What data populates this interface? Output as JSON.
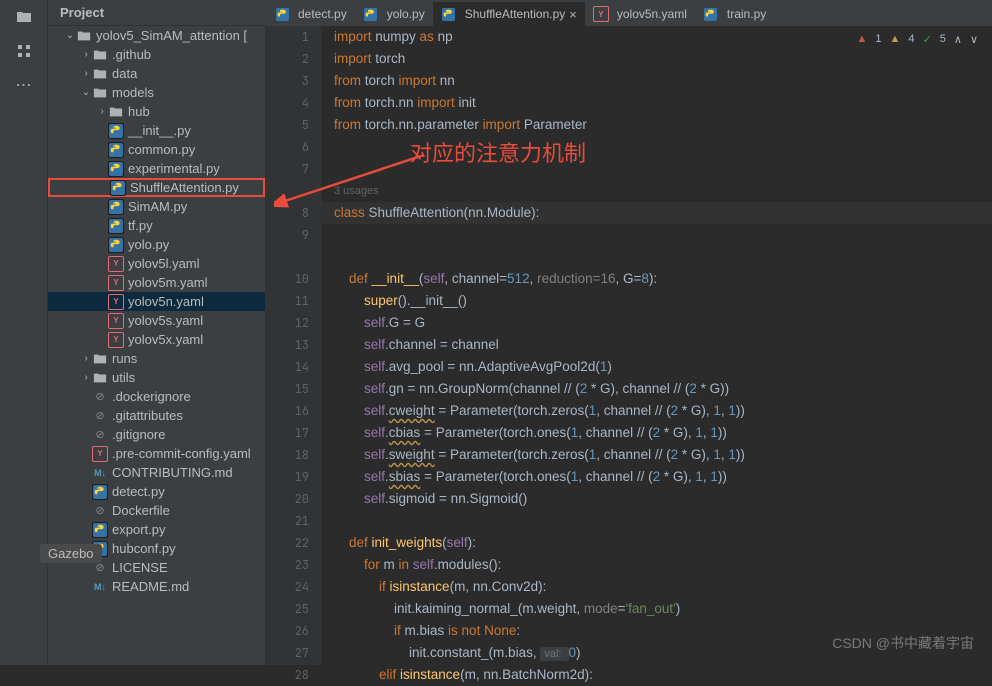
{
  "header": {
    "title": "Project"
  },
  "tree": [
    {
      "indent": 0,
      "chev": "⌄",
      "icon": "dir",
      "label": "yolov5_SimAM_attention ["
    },
    {
      "indent": 1,
      "chev": "›",
      "icon": "dir",
      "label": ".github"
    },
    {
      "indent": 1,
      "chev": "›",
      "icon": "dir",
      "label": "data"
    },
    {
      "indent": 1,
      "chev": "⌄",
      "icon": "dir",
      "label": "models"
    },
    {
      "indent": 2,
      "chev": "›",
      "icon": "dir",
      "label": "hub"
    },
    {
      "indent": 2,
      "chev": "",
      "icon": "py",
      "label": "__init__.py"
    },
    {
      "indent": 2,
      "chev": "",
      "icon": "py",
      "label": "common.py"
    },
    {
      "indent": 2,
      "chev": "",
      "icon": "py",
      "label": "experimental.py"
    },
    {
      "indent": 2,
      "chev": "",
      "icon": "py",
      "label": "ShuffleAttention.py",
      "highlighted": true
    },
    {
      "indent": 2,
      "chev": "",
      "icon": "py",
      "label": "SimAM.py"
    },
    {
      "indent": 2,
      "chev": "",
      "icon": "py",
      "label": "tf.py"
    },
    {
      "indent": 2,
      "chev": "",
      "icon": "py",
      "label": "yolo.py"
    },
    {
      "indent": 2,
      "chev": "",
      "icon": "yaml",
      "label": "yolov5l.yaml"
    },
    {
      "indent": 2,
      "chev": "",
      "icon": "yaml",
      "label": "yolov5m.yaml"
    },
    {
      "indent": 2,
      "chev": "",
      "icon": "yaml",
      "label": "yolov5n.yaml",
      "selected": true
    },
    {
      "indent": 2,
      "chev": "",
      "icon": "yaml",
      "label": "yolov5s.yaml"
    },
    {
      "indent": 2,
      "chev": "",
      "icon": "yaml",
      "label": "yolov5x.yaml"
    },
    {
      "indent": 1,
      "chev": "›",
      "icon": "dir",
      "label": "runs"
    },
    {
      "indent": 1,
      "chev": "›",
      "icon": "dir",
      "label": "utils"
    },
    {
      "indent": 1,
      "chev": "",
      "icon": "gen",
      "label": ".dockerignore"
    },
    {
      "indent": 1,
      "chev": "",
      "icon": "gen",
      "label": ".gitattributes"
    },
    {
      "indent": 1,
      "chev": "",
      "icon": "gen",
      "label": ".gitignore"
    },
    {
      "indent": 1,
      "chev": "",
      "icon": "yaml",
      "label": ".pre-commit-config.yaml"
    },
    {
      "indent": 1,
      "chev": "",
      "icon": "md",
      "label": "CONTRIBUTING.md"
    },
    {
      "indent": 1,
      "chev": "",
      "icon": "py",
      "label": "detect.py"
    },
    {
      "indent": 1,
      "chev": "",
      "icon": "gen",
      "label": "Dockerfile"
    },
    {
      "indent": 1,
      "chev": "",
      "icon": "py",
      "label": "export.py"
    },
    {
      "indent": 1,
      "chev": "",
      "icon": "py",
      "label": "hubconf.py"
    },
    {
      "indent": 1,
      "chev": "",
      "icon": "gen",
      "label": "LICENSE"
    },
    {
      "indent": 1,
      "chev": "",
      "icon": "md",
      "label": "README.md"
    }
  ],
  "tabs": [
    {
      "icon": "py",
      "label": "detect.py"
    },
    {
      "icon": "py",
      "label": "yolo.py"
    },
    {
      "icon": "py",
      "label": "ShuffleAttention.py",
      "active": true,
      "closable": true
    },
    {
      "icon": "yaml",
      "label": "yolov5n.yaml"
    },
    {
      "icon": "py",
      "label": "train.py"
    }
  ],
  "status": {
    "err": "1",
    "warn": "4",
    "ok": "5"
  },
  "usages_hint": "3 usages",
  "annotation": "对应的注意力机制",
  "gazebo": "Gazebo",
  "watermark": "CSDN @书中藏着宇宙",
  "gutter_lines": [
    "1",
    "2",
    "3",
    "4",
    "5",
    "6",
    "7",
    "",
    "8",
    "9",
    "",
    "10",
    "11",
    "12",
    "13",
    "14",
    "15",
    "16",
    "17",
    "18",
    "19",
    "20",
    "21",
    "22",
    "23",
    "24",
    "25",
    "26",
    "27",
    "28"
  ],
  "code": {
    "l1": {
      "a": "import",
      "b": " numpy ",
      "c": "as",
      "d": " np"
    },
    "l2": {
      "a": "import",
      "b": " torch"
    },
    "l3": {
      "a": "from",
      "b": " torch ",
      "c": "import",
      "d": " nn"
    },
    "l4": {
      "a": "from",
      "b": " torch.nn ",
      "c": "import",
      "d": " init"
    },
    "l5": {
      "a": "from",
      "b": " torch.nn.parameter ",
      "c": "import",
      "d": " Parameter"
    },
    "l8": {
      "a": "class ",
      "b": "ShuffleAttention",
      "c": "(nn.Module):"
    },
    "l10": {
      "a": "    ",
      "b": "def ",
      "c": "__init__",
      "d": "(",
      "e": "self",
      "f": ", channel=",
      "g": "512",
      "h": ", ",
      "i": "reduction=16",
      "j": ", G=",
      "k": "8",
      "l": "):"
    },
    "l11": {
      "a": "        ",
      "b": "super",
      "c": "().",
      "d": "__init__",
      "e": "()"
    },
    "l12": {
      "a": "        ",
      "b": "self",
      "c": ".G = G"
    },
    "l13": {
      "a": "        ",
      "b": "self",
      "c": ".channel = channel"
    },
    "l14": {
      "a": "        ",
      "b": "self",
      "c": ".avg_pool = nn.AdaptiveAvgPool2d(",
      "d": "1",
      "e": ")"
    },
    "l15": {
      "a": "        ",
      "b": "self",
      "c": ".gn = nn.GroupNorm(channel // (",
      "d": "2",
      "e": " * G), channel // (",
      "f": "2",
      "g": " * G))"
    },
    "l16": {
      "a": "        ",
      "b": "self",
      "c": ".",
      "d": "cweight",
      "e": " = Parameter(torch.zeros(",
      "f": "1",
      "g": ", channel // (",
      "h": "2",
      "i": " * G), ",
      "j": "1",
      "k": ", ",
      "l": "1",
      "m": "))"
    },
    "l17": {
      "a": "        ",
      "b": "self",
      "c": ".",
      "d": "cbias",
      "e": " = Parameter(torch.ones(",
      "f": "1",
      "g": ", channel // (",
      "h": "2",
      "i": " * G), ",
      "j": "1",
      "k": ", ",
      "l": "1",
      "m": "))"
    },
    "l18": {
      "a": "        ",
      "b": "self",
      "c": ".",
      "d": "sweight",
      "e": " = Parameter(torch.zeros(",
      "f": "1",
      "g": ", channel // (",
      "h": "2",
      "i": " * G), ",
      "j": "1",
      "k": ", ",
      "l": "1",
      "m": "))"
    },
    "l19": {
      "a": "        ",
      "b": "self",
      "c": ".",
      "d": "sbias",
      "e": " = Parameter(torch.ones(",
      "f": "1",
      "g": ", channel // (",
      "h": "2",
      "i": " * G), ",
      "j": "1",
      "k": ", ",
      "l": "1",
      "m": "))"
    },
    "l20": {
      "a": "        ",
      "b": "self",
      "c": ".sigmoid = nn.Sigmoid()"
    },
    "l22": {
      "a": "    ",
      "b": "def ",
      "c": "init_weights",
      "d": "(",
      "e": "self",
      "f": "):"
    },
    "l23": {
      "a": "        ",
      "b": "for ",
      "c": "m ",
      "d": "in ",
      "e": "self",
      "f": ".modules():"
    },
    "l24": {
      "a": "            ",
      "b": "if ",
      "c": "isinstance",
      "d": "(m, nn.Conv2d):"
    },
    "l25": {
      "a": "                init.kaiming_normal_(m.weight, ",
      "b": "mode",
      "c": "=",
      "d": "'fan_out'",
      "e": ")"
    },
    "l26": {
      "a": "                ",
      "b": "if ",
      "c": "m.bias ",
      "d": "is not None",
      "e": ":"
    },
    "l27": {
      "a": "                    init.constant_(m.bias, ",
      "hint": "val: ",
      "b": "0",
      "c": ")"
    },
    "l28": {
      "a": "            ",
      "b": "elif ",
      "c": "isinstance",
      "d": "(m, nn.BatchNorm2d):"
    }
  }
}
